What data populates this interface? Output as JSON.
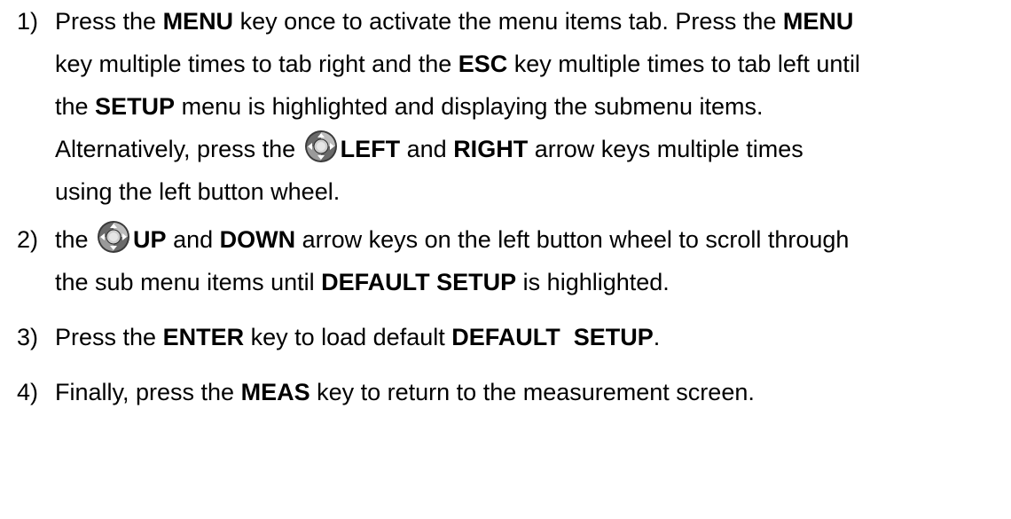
{
  "steps": [
    {
      "number": "1)",
      "parts": {
        "p1": "Press the ",
        "b1": "MENU",
        "p2": " key once to activate the menu items tab.  Press the ",
        "b2": "MENU",
        "p3": "key multiple times to tab right and the ",
        "b3": "ESC",
        "p4": " key multiple times to tab left until",
        "p5": "the ",
        "b4": "SETUP",
        "p6": " menu is highlighted and displaying the submenu items.",
        "p7": "Alternatively, press the ",
        "b5": "LEFT",
        "p8": " and ",
        "b6": "RIGHT",
        "p9": " arrow keys multiple times",
        "p10": "using the left button wheel."
      }
    },
    {
      "number": "2)",
      "parts": {
        "p1": "the ",
        "b1": "UP",
        "p2": " and ",
        "b2": "DOWN",
        "p3": " arrow keys on the left button wheel to scroll through",
        "p4": "the sub menu items until ",
        "b3": "DEFAULT SETUP",
        "p5": " is highlighted."
      }
    },
    {
      "number": "3)",
      "parts": {
        "p1": "Press the ",
        "b1": "ENTER",
        "p2": " key to load default ",
        "b2": "DEFAULT  SETUP",
        "p3": "."
      }
    },
    {
      "number": "4)",
      "parts": {
        "p1": "Finally, press the ",
        "b1": "MEAS",
        "p2": " key to return to the measurement screen."
      }
    }
  ],
  "icons": {
    "button_wheel": "button-wheel-icon"
  },
  "colors": {
    "text": "#000000",
    "wheel_dark": "#3a3a3a",
    "wheel_light": "#cfcfcf"
  }
}
